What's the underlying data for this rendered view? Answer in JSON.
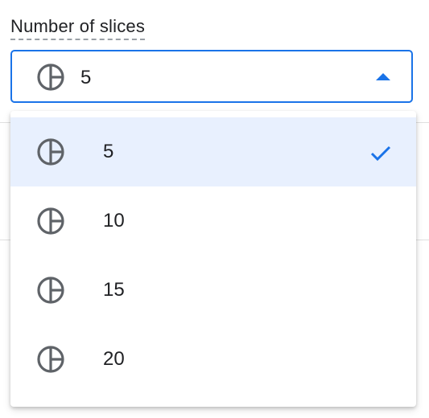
{
  "field": {
    "label": "Number of slices",
    "selected_value": "5",
    "icon": "pie-chart-icon"
  },
  "menu": {
    "items": [
      {
        "label": "5",
        "icon": "pie-chart-icon",
        "selected": true
      },
      {
        "label": "10",
        "icon": "pie-chart-icon",
        "selected": false
      },
      {
        "label": "15",
        "icon": "pie-chart-icon",
        "selected": false
      },
      {
        "label": "20",
        "icon": "pie-chart-icon",
        "selected": false
      }
    ],
    "check_icon": "check-icon"
  },
  "colors": {
    "accent": "#1a73e8",
    "selected_bg": "#e8f0fe",
    "icon_gray": "#5f6368",
    "text": "#202124"
  }
}
